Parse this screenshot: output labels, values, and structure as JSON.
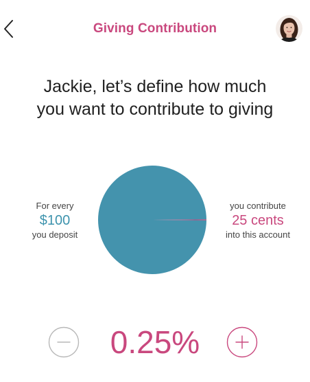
{
  "header": {
    "title": "Giving Contribution"
  },
  "headline": {
    "line1": "Jackie, let’s define how much",
    "line2": "you want to contribute to giving"
  },
  "left_info": {
    "top": "For every",
    "amount": "$100",
    "bottom": "you deposit"
  },
  "right_info": {
    "top": "you contribute",
    "amount": "25 cents",
    "bottom": "into this account"
  },
  "chart_data": {
    "type": "pie",
    "values": [
      99.75,
      0.25
    ],
    "colors": [
      "#4493ad",
      "#c9487e"
    ]
  },
  "contribution": {
    "percent": "0.25%",
    "value": 0.25
  },
  "icons": {
    "back": "back-chevron-icon",
    "avatar": "user-avatar",
    "minus": "minus-circle-icon",
    "plus": "plus-circle-icon"
  },
  "colors": {
    "accent_pink": "#c9487e",
    "accent_teal": "#3d93ad"
  }
}
